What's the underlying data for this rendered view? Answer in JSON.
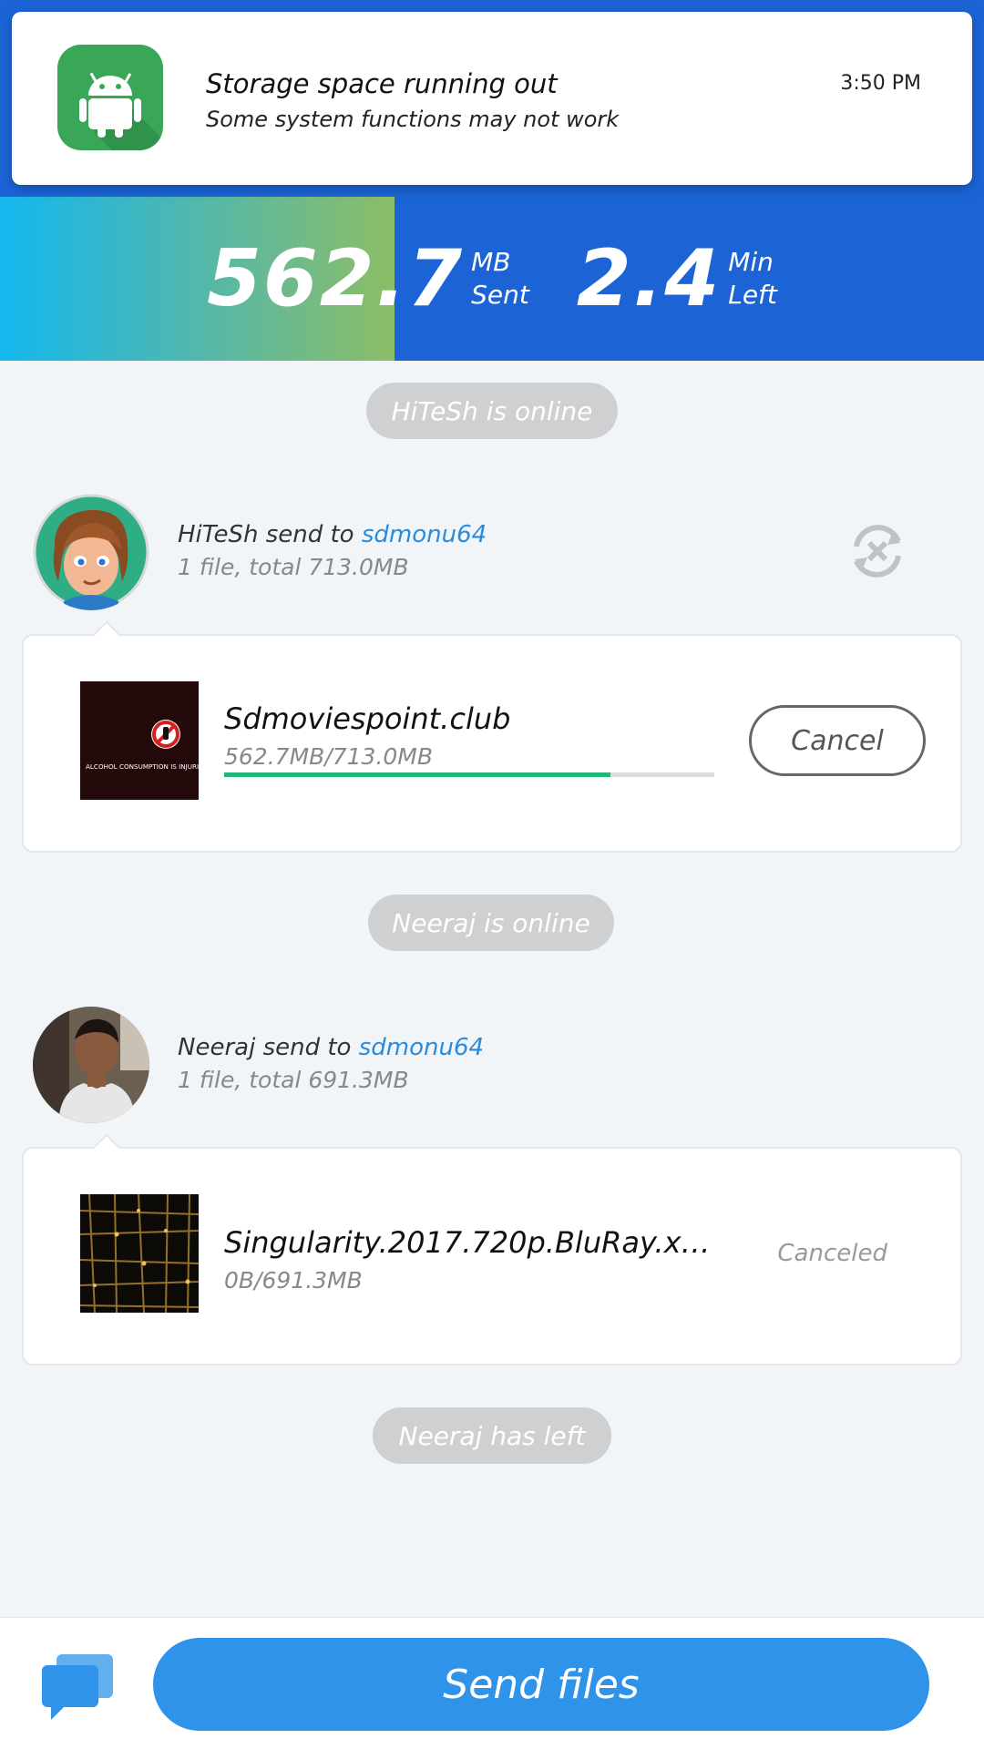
{
  "notification": {
    "title": "Storage space running out",
    "subtitle": "Some system functions may not work",
    "time": "3:50 PM",
    "icon": "android-icon"
  },
  "transfer": {
    "sent_value": "562.7",
    "sent_unit_top": "MB",
    "sent_unit_bottom": "Sent",
    "left_value": "2.4",
    "left_unit_top": "Min",
    "left_unit_bottom": "Left",
    "progress_fraction": 0.789
  },
  "events": [
    {
      "text": "HiTeSh is online"
    },
    {
      "text": "Neeraj is online"
    },
    {
      "text": "Neeraj has left"
    }
  ],
  "transfers": [
    {
      "sender": "HiTeSh",
      "send_to_text": "send to",
      "recipient": "sdmonu64",
      "meta": "1 file, total 713.0MB",
      "file_name": "Sdmoviespoint.club",
      "file_size": "562.7MB/713.0MB",
      "progress_fraction": 0.789,
      "action_label": "Cancel",
      "thumb_caption": "ALCOHOL CONSUMPTION IS INJURIO"
    },
    {
      "sender": "Neeraj",
      "send_to_text": "send to",
      "recipient": "sdmonu64",
      "meta": "1 file, total 691.3MB",
      "file_name": "Singularity.2017.720p.BluRay.x…",
      "file_size": "0B/691.3MB",
      "status": "Canceled"
    }
  ],
  "bottom_bar": {
    "send_label": "Send files"
  },
  "colors": {
    "header_blue": "#1c64d6",
    "progress_green": "#22b57a",
    "link_blue": "#2a8bdc",
    "button_blue": "#2f93ea"
  }
}
